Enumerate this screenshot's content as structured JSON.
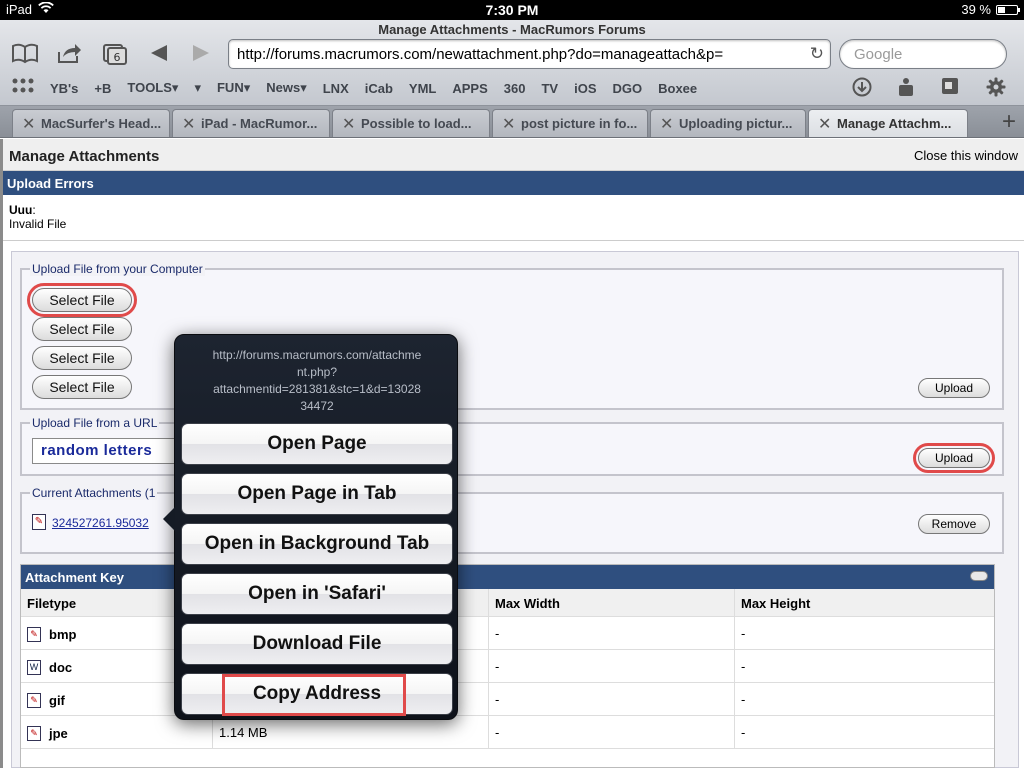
{
  "status": {
    "device": "iPad",
    "time": "7:30 PM",
    "battery": "39 %",
    "battery_level": 0.39
  },
  "browser": {
    "window_title": "Manage Attachments - MacRumors Forums",
    "url": "http://forums.macrumors.com/newattachment.php?do=manageattach&p=",
    "search_placeholder": "Google",
    "tab_count_badge": "6",
    "bookmarks": [
      "YB's",
      "+B",
      "TOOLS▾",
      "▾",
      "FUN▾",
      "News▾",
      "LNX",
      "iCab",
      "YML",
      "APPS",
      "360",
      "TV",
      "iOS",
      "DGO",
      "Boxee"
    ],
    "tabs": [
      {
        "label": "MacSurfer's Head..."
      },
      {
        "label": "iPad - MacRumor..."
      },
      {
        "label": "Possible to load..."
      },
      {
        "label": "post picture in fo..."
      },
      {
        "label": "Uploading pictur..."
      },
      {
        "label": "Manage Attachm..."
      }
    ]
  },
  "page": {
    "title": "Manage Attachments",
    "close_link": "Close this window",
    "errors": {
      "heading": "Upload Errors",
      "file": "Uuu",
      "separator": ":",
      "message": "Invalid File"
    },
    "upload_computer": {
      "legend": "Upload File from your Computer",
      "buttons": [
        "Select File",
        "Select File",
        "Select File",
        "Select File"
      ],
      "upload_label": "Upload"
    },
    "upload_url": {
      "legend": "Upload File from a URL",
      "value": "random letters",
      "upload_label": "Upload"
    },
    "current": {
      "legend": "Current Attachments (1",
      "file_link": "324527261.95032",
      "remove_label": "Remove"
    },
    "key": {
      "heading": "Attachment Key",
      "columns": [
        "Filetype",
        "",
        "Max Width",
        "Max Height"
      ],
      "rows": [
        {
          "type": "bmp",
          "size": "",
          "width": "-",
          "height": "-"
        },
        {
          "type": "doc",
          "size": "",
          "width": "-",
          "height": "-"
        },
        {
          "type": "gif",
          "size": "",
          "width": "-",
          "height": "-"
        },
        {
          "type": "jpe",
          "size": "1.14 MB",
          "width": "-",
          "height": "-"
        }
      ]
    }
  },
  "popover": {
    "url": "http://forums.macrumors.com/attachment.php?attachmentid=281381&stc=1&d=1302834472",
    "url_lines": [
      "http://forums.macrumors.com/attachme",
      "nt.php?",
      "attachmentid=281381&stc=1&d=13028",
      "34472"
    ],
    "actions": [
      "Open Page",
      "Open Page in Tab",
      "Open in Background Tab",
      "Open in 'Safari'",
      "Download File",
      "Copy Address"
    ]
  }
}
